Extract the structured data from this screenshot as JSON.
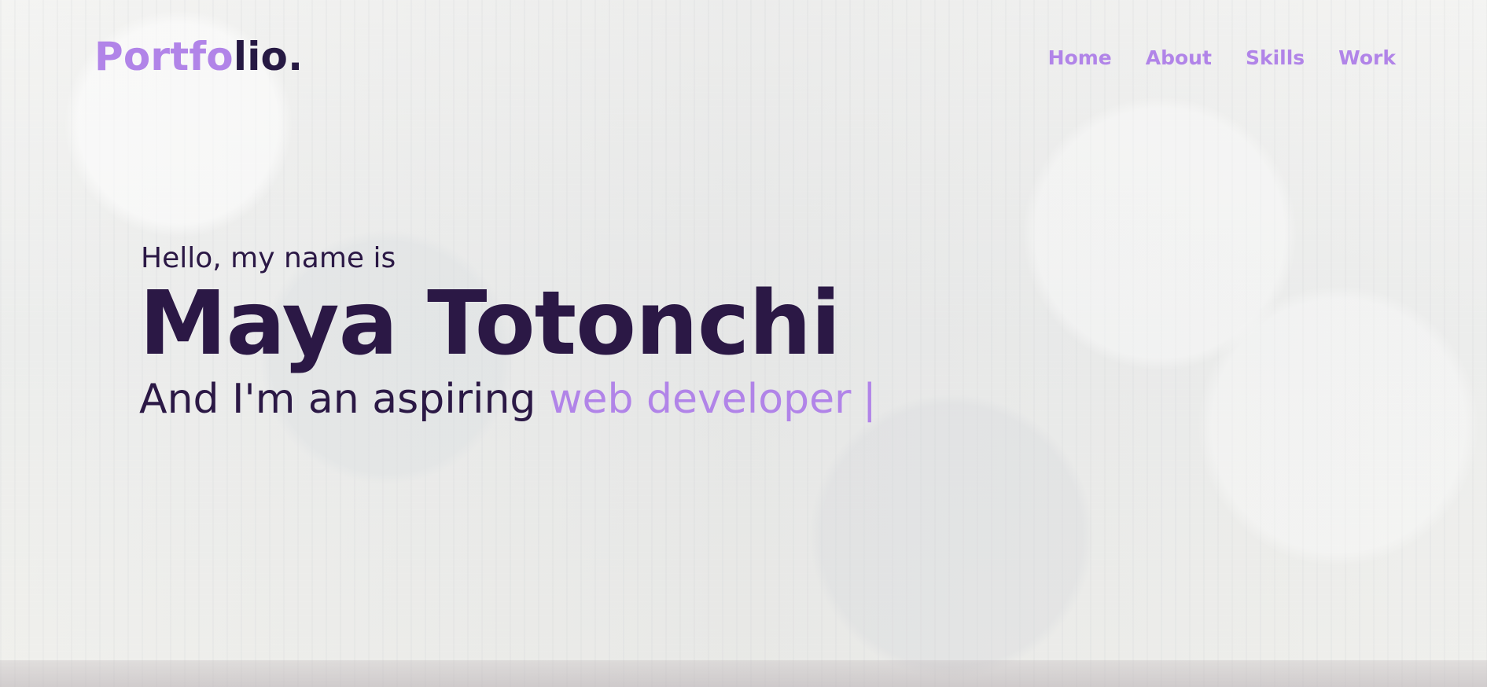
{
  "header": {
    "logo_part1": "Portfo",
    "logo_part2": "lio."
  },
  "nav": {
    "items": [
      "Home",
      "About",
      "Skills",
      "Work"
    ]
  },
  "hero": {
    "greeting": "Hello, my name is",
    "name": "Maya Totonchi",
    "subtitle_prefix": "And I'm an aspiring ",
    "subtitle_highlight": "web developer",
    "cursor": "|"
  },
  "colors": {
    "accent": "#b184e8",
    "primary_text": "#2b1845",
    "background": "#e9e9e7"
  }
}
